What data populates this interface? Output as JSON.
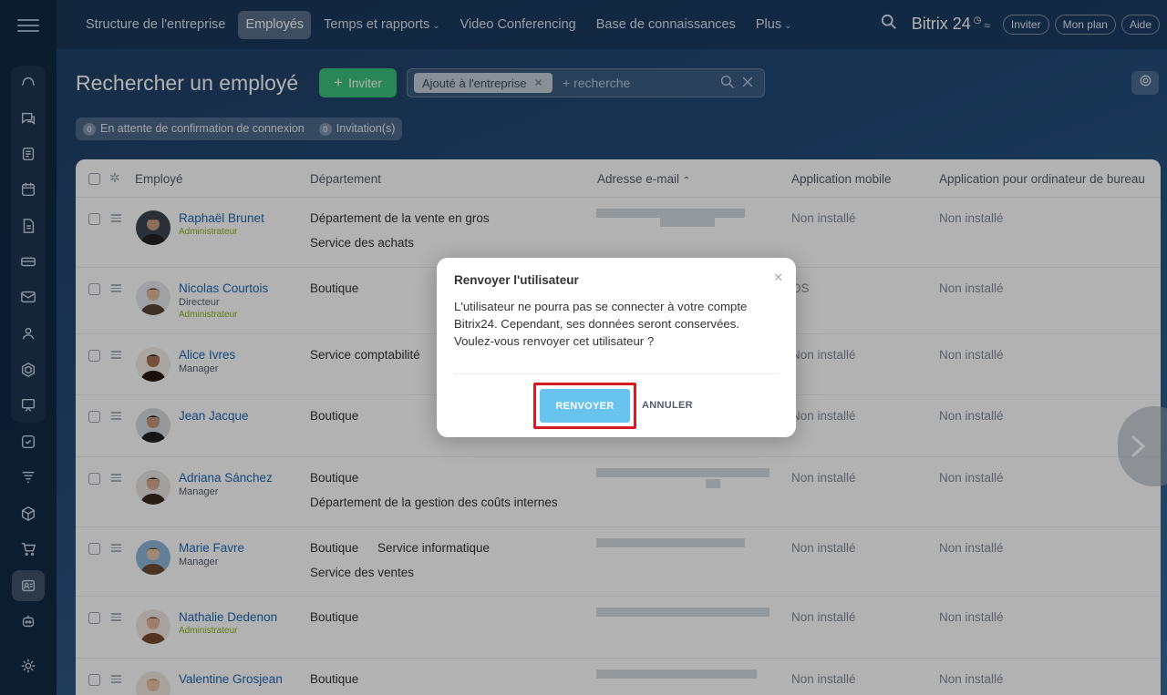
{
  "topnav": {
    "items": [
      {
        "label": "Structure de l'entreprise",
        "caret": false,
        "active": false
      },
      {
        "label": "Employés",
        "caret": false,
        "active": true
      },
      {
        "label": "Temps et rapports",
        "caret": true,
        "active": false
      },
      {
        "label": "Video Conferencing",
        "caret": false,
        "active": false
      },
      {
        "label": "Base de connaissances",
        "caret": false,
        "active": false
      },
      {
        "label": "Plus",
        "caret": true,
        "active": false
      }
    ],
    "brand": "Bitrix 24",
    "invite": "Inviter",
    "plan": "Mon plan",
    "help": "Aide"
  },
  "header": {
    "title": "Rechercher un employé",
    "invite_button": "Inviter",
    "filter_tag": "Ajouté à l'entreprise",
    "search_placeholder": "+ recherche"
  },
  "counters": {
    "pending_count": "0",
    "pending_label": "En attente de confirmation de connexion",
    "invites_count": "0",
    "invites_label": "Invitation(s)"
  },
  "table": {
    "columns": {
      "employee": "Employé",
      "department": "Département",
      "email": "Adresse e-mail",
      "mobile": "Application mobile",
      "desktop": "Application pour ordinateur de bureau"
    },
    "rows": [
      {
        "name": "Raphaël Brunet",
        "position": "",
        "role": "Administrateur",
        "dept1": "Département de la vente en gros",
        "dept2": "Service des achats",
        "mobile": "Non installé",
        "desktop": "Non installé"
      },
      {
        "name": "Nicolas Courtois",
        "position": "Directeur",
        "role": "Administrateur",
        "dept1": "Boutique",
        "dept2": "",
        "mobile": "OS",
        "desktop": "Non installé"
      },
      {
        "name": "Alice Ivres",
        "position": "Manager",
        "role": "",
        "dept1": "Service comptabilité",
        "dept2": "",
        "mobile": "Non installé",
        "desktop": "Non installé"
      },
      {
        "name": "Jean Jacque",
        "position": "",
        "role": "",
        "dept1": "Boutique",
        "dept2": "",
        "mobile": "Non installé",
        "desktop": "Non installé"
      },
      {
        "name": "Adriana Sánchez",
        "position": "Manager",
        "role": "",
        "dept1": "Boutique",
        "dept2": "Département de la gestion des coûts internes",
        "mobile": "Non installé",
        "desktop": "Non installé"
      },
      {
        "name": "Marie Favre",
        "position": "Manager",
        "role": "",
        "dept1": "Boutique",
        "dept1b": "Service informatique",
        "dept2": "Service des ventes",
        "mobile": "Non installé",
        "desktop": "Non installé"
      },
      {
        "name": "Nathalie Dedenon",
        "position": "",
        "role": "Administrateur",
        "dept1": "Boutique",
        "dept2": "",
        "mobile": "Non installé",
        "desktop": "Non installé"
      },
      {
        "name": "Valentine Grosjean",
        "position": "",
        "role": "",
        "dept1": "Boutique",
        "dept2": "",
        "mobile": "Non installé",
        "desktop": "Non installé"
      }
    ]
  },
  "modal": {
    "title": "Renvoyer l'utilisateur",
    "line1": "L'utilisateur ne pourra pas se connecter à votre compte",
    "line2": "Bitrix24. Cependant, ses données seront conservées.",
    "line3": "Voulez-vous renvoyer cet utilisateur ?",
    "confirm": "RENVOYER",
    "cancel": "ANNULER"
  },
  "colors": {
    "accent_green": "#3bc07c",
    "link_blue": "#2067b0",
    "admin_green": "#8cb01c",
    "confirm_button": "#68c4ee",
    "highlight_red": "#d81a23"
  }
}
